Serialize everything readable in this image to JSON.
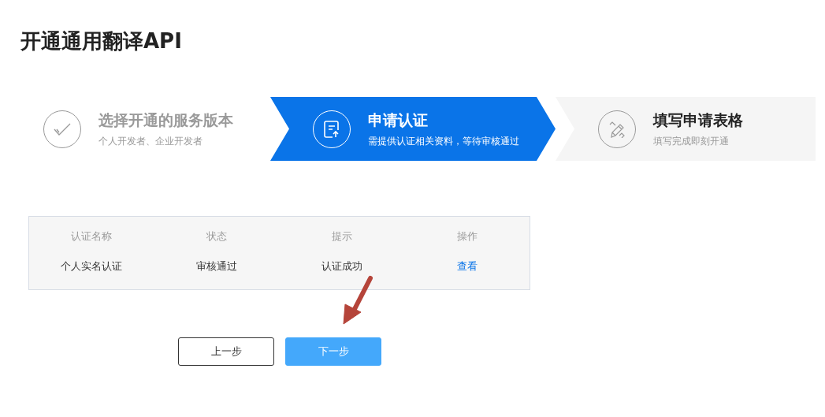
{
  "title": "开通通用翻译API",
  "steps": [
    {
      "title": "选择开通的服务版本",
      "subtitle": "个人开发者、企业开发者",
      "kind": "done"
    },
    {
      "title": "申请认证",
      "subtitle": "需提供认证相关资料，等待审核通过",
      "kind": "active"
    },
    {
      "title": "填写申请表格",
      "subtitle": "填写完成即刻开通",
      "kind": "todo"
    }
  ],
  "table": {
    "columns": [
      "认证名称",
      "状态",
      "提示",
      "操作"
    ],
    "rows": [
      {
        "cells": [
          "个人实名认证",
          "审核通过",
          "认证成功"
        ],
        "action": "查看"
      }
    ]
  },
  "buttons": [
    {
      "label": "上一步",
      "kind": "secondary"
    },
    {
      "label": "下一步",
      "kind": "primary"
    }
  ]
}
